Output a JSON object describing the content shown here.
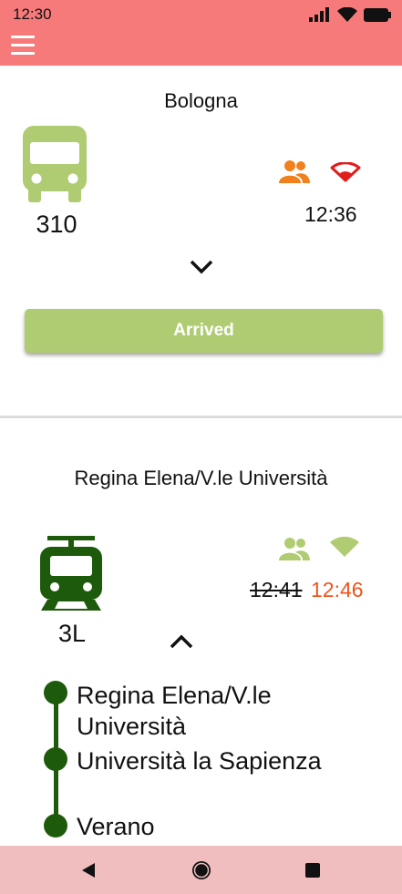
{
  "status_bar": {
    "time": "12:30"
  },
  "colors": {
    "app_bar": "#f77a7a",
    "accent_green": "#afcc72",
    "dark_green": "#1e5a0c",
    "orange": "#f0811c",
    "late_red": "#f0531c",
    "nav_bar": "#f0bebe"
  },
  "card1": {
    "stop_name": "Bologna",
    "vehicle_icon": "bus-icon",
    "route": "310",
    "time": "12:36",
    "crowd_icon": "people-icon",
    "signal_icon": "wifi-icon",
    "arrived_label": "Arrived"
  },
  "card2": {
    "stop_name": "Regina Elena/V.le Università",
    "vehicle_icon": "tram-icon",
    "route": "3L",
    "scheduled_time": "12:41",
    "expected_time": "12:46",
    "stops": [
      {
        "name_line1": "Regina Elena/V.le",
        "name_line2": "Università"
      },
      {
        "name_line1": "Università la Sapienza"
      },
      {
        "name_line1": "Verano"
      }
    ]
  },
  "nav": {
    "back_icon": "back-icon",
    "home_icon": "home-icon",
    "recents_icon": "recents-icon"
  }
}
